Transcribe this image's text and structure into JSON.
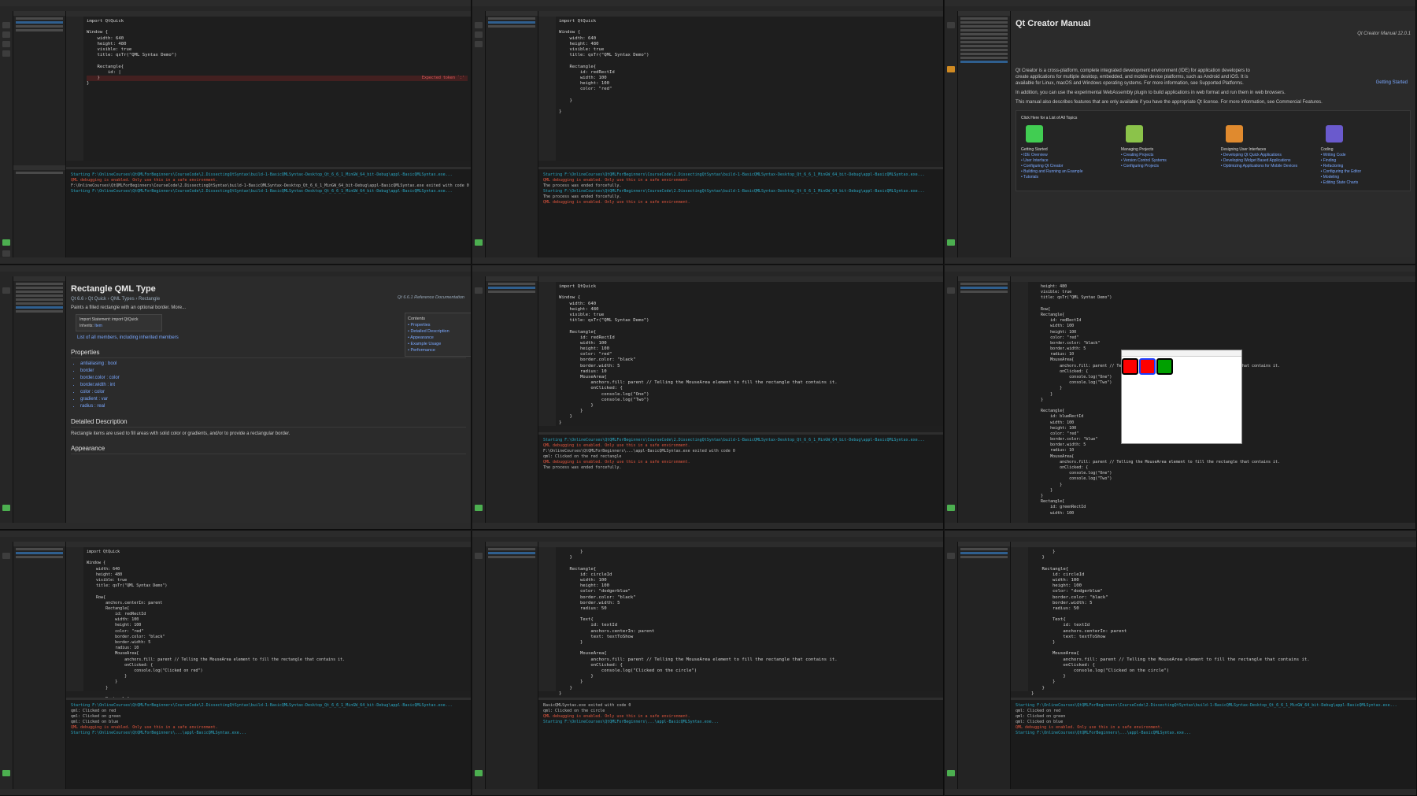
{
  "panels": [
    {
      "id": "p1",
      "code": [
        "import QtQuick",
        "",
        "Window {",
        "    width: 640",
        "    height: 480",
        "    visible: true",
        "    title: qsTr(\"QML Syntax Demo\")",
        "",
        "    Rectangle{",
        "        id: |",
        "    }",
        "}"
      ],
      "error": "Expected token `:'",
      "output": [
        "Starting F:\\OnlineCourses\\QtQMLForBeginners\\CourseCode\\2.DissectingQtSyntax\\build-1-BasicQMLSyntax-Desktop_Qt_6_6_1_MinGW_64_bit-Debug\\appl-BasicQMLSyntax.exe...",
        "QML debugging is enabled. Only use this in a safe environment.",
        "F:\\OnlineCourses\\QtQMLForBeginners\\CourseCode\\2.DissectingQtSyntax\\build-1-BasicQMLSyntax-Desktop_Qt_6_6_1_MinGW_64_bit-Debug\\appl-BasicQMLSyntax.exe exited with code 0",
        "",
        "Starting F:\\OnlineCourses\\QtQMLForBeginners\\CourseCode\\2.DissectingQtSyntax\\build-1-BasicQMLSyntax-Desktop_Qt_6_6_1_MinGW_64_bit-Debug\\appl-BasicQMLSyntax.exe..."
      ]
    },
    {
      "id": "p2",
      "code": [
        "import QtQuick",
        "",
        "Window {",
        "    width: 640",
        "    height: 480",
        "    visible: true",
        "    title: qsTr(\"QML Syntax Demo\")",
        "",
        "    Rectangle{",
        "        id: redRectId",
        "        width: 100",
        "        height: 100",
        "        color: \"red\"",
        "",
        "    }",
        "",
        "}"
      ],
      "output": [
        "Starting F:\\OnlineCourses\\QtQMLForBeginners\\CourseCode\\2.DissectingQtSyntax\\build-1-BasicQMLSyntax-Desktop_Qt_6_6_1_MinGW_64_bit-Debug\\appl-BasicQMLSyntax.exe...",
        "QML debugging is enabled. Only use this in a safe environment.",
        "The process was ended forcefully.",
        "",
        "Starting F:\\OnlineCourses\\QtQMLForBeginners\\CourseCode\\2.DissectingQtSyntax\\build-1-BasicQMLSyntax-Desktop_Qt_6_6_1_MinGW_64_bit-Debug\\appl-BasicQMLSyntax.exe...",
        "The process was ended forcefully.",
        "",
        "QML debugging is enabled. Only use this in a safe environment."
      ]
    },
    {
      "id": "p4",
      "code": [
        "import QtQuick",
        "",
        "Window {",
        "    width: 640",
        "    height: 480",
        "    visible: true",
        "    title: qsTr(\"QML Syntax Demo\")",
        "",
        "    Rectangle{",
        "        id: redRectId",
        "        width: 100",
        "        height: 100",
        "        color: \"red\"",
        "        border.color: \"black\"",
        "        border.width: 5",
        "        radius: 10",
        "        MouseArea{",
        "            anchors.fill: parent // Telling the MouseArea element to fill the rectangle that contains it.",
        "            onClicked: {",
        "                console.log(\"One\")",
        "                console.log(\"Two\")",
        "            }",
        "        }",
        "    }",
        "}"
      ],
      "output": [
        "Starting F:\\OnlineCourses\\QtQMLForBeginners\\CourseCode\\2.DissectingQtSyntax\\build-1-BasicQMLSyntax-Desktop_Qt_6_6_1_MinGW_64_bit-Debug\\appl-BasicQMLSyntax.exe...",
        "QML debugging is enabled. Only use this in a safe environment.",
        "F:\\OnlineCourses\\QtQMLForBeginners\\...\\appl-BasicQMLSyntax.exe exited with code 0",
        "",
        "qml: Clicked on the red rectangle",
        "QML debugging is enabled. Only use this in a safe environment.",
        "The process was ended forcefully."
      ]
    },
    {
      "id": "p5",
      "code": [
        "    height: 480",
        "    visible: true",
        "    title: qsTr(\"QML Syntax Demo\")",
        "",
        "    Row{",
        "    Rectangle{",
        "        id: redRectId",
        "        width: 100",
        "        height: 100",
        "        color: \"red\"",
        "        border.color: \"black\"",
        "        border.width: 5",
        "        radius: 10",
        "        MouseArea{",
        "            anchors.fill: parent // Telling the MouseArea element to fill the rectangle that contains it.",
        "            onClicked: {",
        "                console.log(\"One\")",
        "                console.log(\"Two\")",
        "            }",
        "        }",
        "    }",
        "",
        "    Rectangle{",
        "        id: blueRectId",
        "        width: 100",
        "        height: 100",
        "        color: \"red\"",
        "        border.color: \"blue\"",
        "        border.width: 5",
        "        radius: 10",
        "        MouseArea{",
        "            anchors.fill: parent // Telling the MouseArea element to fill the rectangle that contains it.",
        "            onClicked: {",
        "                console.log(\"One\")",
        "                console.log(\"Two\")",
        "            }",
        "        }",
        "    }",
        "    Rectangle{",
        "        id: greenRectId",
        "        width: 100"
      ]
    },
    {
      "id": "p6",
      "code": [
        "import QtQuick",
        "",
        "Window {",
        "    width: 640",
        "    height: 480",
        "    visible: true",
        "    title: qsTr(\"QML Syntax Demo\")",
        "",
        "    Row{",
        "        anchors.centerIn: parent",
        "        Rectangle{",
        "            id: redRectId",
        "            width: 100",
        "            height: 100",
        "            color: \"red\"",
        "            border.color: \"black\"",
        "            border.width: 5",
        "            radius: 10",
        "            MouseArea{",
        "                anchors.fill: parent // Telling the MouseArea element to fill the rectangle that contains it.",
        "                onClicked: {",
        "                    console.log(\"Clicked on red\")",
        "                }",
        "            }",
        "        }",
        "",
        "        Rectangle{",
        "            id: blueRectId",
        "            width: 100",
        "            height: 100",
        "            color: \"green\""
      ],
      "output": [
        "Starting F:\\OnlineCourses\\QtQMLForBeginners\\CourseCode\\2.DissectingQtSyntax\\build-1-BasicQMLSyntax-Desktop_Qt_6_6_1_MinGW_64_bit-Debug\\appl-BasicQMLSyntax.exe...",
        "qml: Clicked on red",
        "qml: Clicked on green",
        "qml: Clicked on blue",
        "QML debugging is enabled. Only use this in a safe environment.",
        "Starting F:\\OnlineCourses\\QtQMLForBeginners\\...\\appl-BasicQMLSyntax.exe..."
      ]
    },
    {
      "id": "p7",
      "code": [
        "        }",
        "    }",
        "",
        "    Rectangle{",
        "        id: circleId",
        "        width: 100",
        "        height: 100",
        "        color: \"dodgerblue\"",
        "        border.color: \"black\"",
        "        border.width: 5",
        "        radius: 50",
        "",
        "        Text{",
        "            id: textId",
        "            anchors.centerIn: parent",
        "            text: textToShow",
        "        }",
        "",
        "        MouseArea{",
        "            anchors.fill: parent // Telling the MouseArea element to fill the rectangle that contains it.",
        "            onClicked: {",
        "                console.log(\"Clicked on the circle\")",
        "            }",
        "        }",
        "    }",
        "}"
      ],
      "output": [
        "BasicQMLSyntax.exe exited with code 0",
        "",
        "qml: Clicked on the circle",
        "QML debugging is enabled. Only use this in a safe environment.",
        "Starting F:\\OnlineCourses\\QtQMLForBeginners\\...\\appl-BasicQMLSyntax.exe..."
      ]
    },
    {
      "id": "p8",
      "code": [
        "        }",
        "    }",
        "",
        "    Rectangle{",
        "        id: circleId",
        "        width: 100",
        "        height: 100",
        "        color: \"dodgerblue\"",
        "        border.color: \"black\"",
        "        border.width: 5",
        "        radius: 50",
        "",
        "        Text{",
        "            id: textId",
        "            anchors.centerIn: parent",
        "            text: textToShow",
        "        }",
        "",
        "        MouseArea{",
        "            anchors.fill: parent // Telling the MouseArea element to fill the rectangle that contains it.",
        "            onClicked: {",
        "                console.log(\"Clicked on the circle\")",
        "            }",
        "        }",
        "    }",
        "}"
      ],
      "output": [
        "Starting F:\\OnlineCourses\\QtQMLForBeginners\\CourseCode\\2.DissectingQtSyntax\\build-1-BasicQMLSyntax-Desktop_Qt_6_6_1_MinGW_64_bit-Debug\\appl-BasicQMLSyntax.exe...",
        "qml: Clicked on red",
        "qml: Clicked on green",
        "qml: Clicked on blue",
        "QML debugging is enabled. Only use this in a safe environment.",
        "Starting F:\\OnlineCourses\\QtQMLForBeginners\\...\\appl-BasicQMLSyntax.exe..."
      ]
    }
  ],
  "manual": {
    "title": "Qt Creator Manual",
    "version": "Qt Creator Manual 12.0.1",
    "intro": "Qt Creator is a cross-platform, complete integrated development environment (IDE) for application developers to create applications for multiple desktop, embedded, and mobile device platforms, such as Android and iOS. It is available for Linux, macOS and Windows operating systems. For more information, see Supported Platforms.",
    "wasm": "In addition, you can use the experimental WebAssembly plugin to build applications in web format and run them in web browsers.",
    "license": "This manual also describes features that are only available if you have the appropriate Qt license. For more information, see Commercial Features.",
    "getting_started_link": "Getting Started",
    "topics_header": "Click Here for a List of All Topics",
    "columns": [
      {
        "title": "Getting Started",
        "items": [
          "IDE Overview",
          "User Interface",
          "Configuring Qt Creator",
          "Building and Running an Example",
          "Tutorials"
        ]
      },
      {
        "title": "Managing Projects",
        "items": [
          "Creating Projects",
          "Version Control Systems",
          "Configuring Projects"
        ]
      },
      {
        "title": "Designing User Interfaces",
        "items": [
          "Developing Qt Quick Applications",
          "Developing Widget Based Applications",
          "Optimizing Applications for Mobile Devices"
        ]
      },
      {
        "title": "Coding",
        "items": [
          "Writing Code",
          "Finding",
          "Refactoring",
          "Configuring the Editor",
          "Modeling",
          "Editing State Charts"
        ]
      }
    ]
  },
  "rect_doc": {
    "title": "Rectangle QML Type",
    "breadcrumb": "Qt 6.6 › Qt Quick › QML Types › Rectangle",
    "ref": "Qt 6.6.1 Reference Documentation",
    "summary": "Paints a filled rectangle with an optional border. More...",
    "import_label": "Import Statement:",
    "import_value": "import QtQuick",
    "inherits_label": "Inherits:",
    "inherits_value": "Item",
    "members_link": "List of all members, including inherited members",
    "contents_title": "Contents",
    "contents": [
      "Properties",
      "Detailed Description",
      "Appearance",
      "Example Usage",
      "Performance"
    ],
    "properties_title": "Properties",
    "properties": [
      "antialiasing : bool",
      "border",
      "border.color : color",
      "border.width : int",
      "color : color",
      "gradient : var",
      "radius : real"
    ],
    "detail_title": "Detailed Description",
    "detail": "Rectangle items are used to fill areas with solid color or gradients, and/or to provide a rectangular border.",
    "appearance_title": "Appearance"
  },
  "colors": {
    "red": "#ff0000",
    "green": "#00a000"
  }
}
